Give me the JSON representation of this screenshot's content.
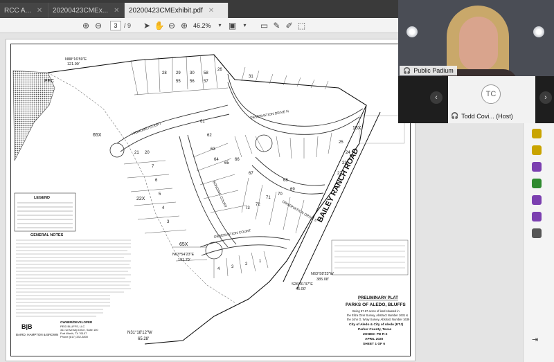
{
  "tabs": [
    {
      "label": "RCC A..."
    },
    {
      "label": "20200423CMEx..."
    },
    {
      "label": "20200423CMExhibit.pdf"
    }
  ],
  "window_title": "20200423CMExhibit.pdf",
  "toolbar": {
    "page_current": "3",
    "page_total": "/ 9",
    "zoom": "46.2%"
  },
  "plat": {
    "titles": {
      "prelim": "PRELIMINARY PLAT",
      "project": "PARKS OF ALEDO, BLUFFS",
      "line1": "Being 87.67 acres of land situated in",
      "line2": "the Eliza Ozer Survey, Abstract Number 1631 &",
      "line3": "the John G. Wray Survey, Abstract Number 1639",
      "line4": "City of Aledo & City of Aledo (ETJ)",
      "county": "Parker County, Texas",
      "zoned": "ZONED: PD R-2",
      "date": "APRIL 2020",
      "sheet": "SHEET 1 OF 6"
    },
    "streets": {
      "observation_drive_n": "OBSERVATION DRIVE N",
      "highland_court": "HIGHLAND COURT",
      "bonding_court": "BONDING COURT",
      "observation_drive_s": "OBSERVATION DRIVE S",
      "observation_court": "OBSERVATION COURT",
      "bailey_ranch_road": "BAILEY RANCH ROAD"
    },
    "bearings": {
      "b1": "N63°54'23\"E",
      "b1d": "141.70'",
      "b2": "S26°01'37\"E",
      "b2d": "45.00'",
      "b3": "N63°58'23\"W",
      "b3d": "385.08'",
      "b4": "N31°18'12\"W",
      "b4d": "65.28'",
      "b5": "N88°16'59\"E",
      "b5d": "121.99'"
    },
    "block_labels": [
      "65X",
      "22X",
      "15X",
      "65X",
      "PFC"
    ],
    "legend_title": "LEGEND",
    "notes_title": "GENERAL NOTES",
    "firm_logo": "B|B",
    "firm_name": "BAIRD, HAMPTON & BROWN",
    "owner_title": "OWNER/DEVELOPER",
    "owner_lines": [
      "PEID BLUFFS, LLC",
      "311 University Drive, Suite 100",
      "Fort Worth, TX 76107",
      "Phone (817) 332-3800"
    ]
  },
  "lots": {
    "north_row": [
      "28",
      "29",
      "30",
      "31",
      "58",
      "57",
      "56",
      "55",
      "26",
      "25",
      "24",
      "23",
      "22",
      "21",
      "20"
    ],
    "center": [
      "61",
      "62",
      "63",
      "64",
      "65",
      "66",
      "67",
      "68",
      "69",
      "70",
      "71",
      "72",
      "73"
    ],
    "misc": [
      "37",
      "38",
      "39",
      "40",
      "27",
      "28",
      "29",
      "19",
      "18",
      "17",
      "16",
      "15",
      "14",
      "13",
      "12",
      "11",
      "10",
      "9",
      "8",
      "7",
      "6",
      "5",
      "4",
      "3",
      "2",
      "1"
    ]
  },
  "video": {
    "speaker_name": "Public Padium",
    "participant_initials": "TC",
    "participant_label": "Todd Covi... (Host)"
  },
  "colors": {
    "accent_purple": "#7b3fb0",
    "accent_yellow": "#c9a400",
    "accent_green": "#2f8a2f"
  }
}
